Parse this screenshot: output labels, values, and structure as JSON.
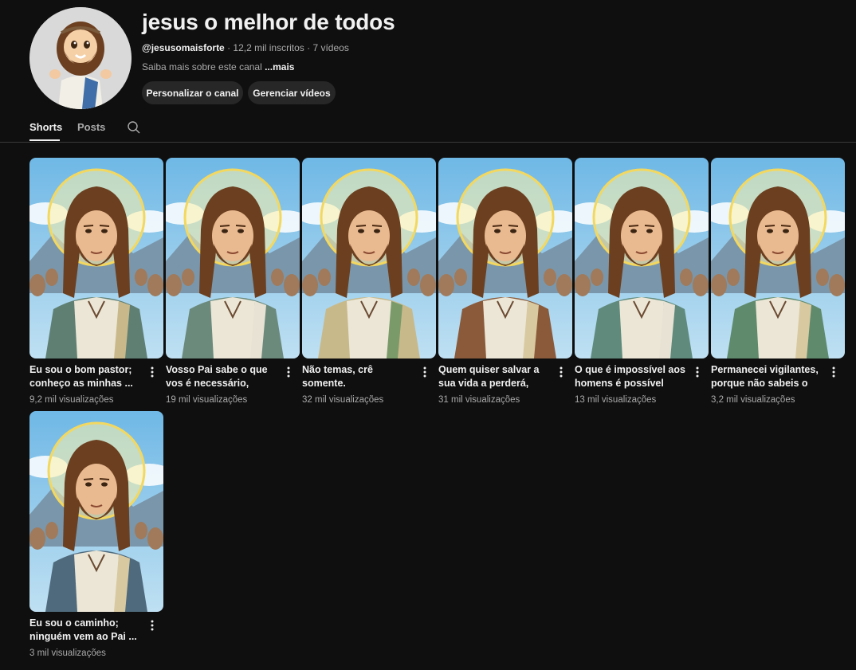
{
  "channel": {
    "name": "jesus o melhor de todos",
    "handle": "@jesusomaisforte",
    "subscribers": "· 12,2 mil inscritos",
    "video_count": "· 7 vídeos",
    "about_text": "Saiba mais sobre este canal",
    "about_more": "...mais",
    "customize_button": "Personalizar o canal",
    "manage_button": "Gerenciar vídeos",
    "avatar_icon": "jesus-cartoon-avatar"
  },
  "tabs": [
    {
      "label": "Shorts",
      "selected": true
    },
    {
      "label": "Posts",
      "selected": false
    }
  ],
  "shorts": [
    {
      "title": "Eu sou o bom pastor; conheço as minhas ...",
      "views": "9,2 mil visualizações"
    },
    {
      "title": "Vosso Pai sabe o que vos é necessário, ante...",
      "views": "19 mil visualizações"
    },
    {
      "title": "Não temas, crê somente.",
      "views": "32 mil visualizações"
    },
    {
      "title": "Quem quiser salvar a sua vida a perderá, ma...",
      "views": "31 mil visualizações"
    },
    {
      "title": "O que é impossível aos homens é possível par...",
      "views": "13 mil visualizações"
    },
    {
      "title": "Permanecei vigilantes, porque não sabeis o di...",
      "views": "3,2 mil visualizações"
    },
    {
      "title": "Eu sou o caminho; ninguém vem ao Pai ...",
      "views": "3 mil visualizações"
    }
  ],
  "colors": {
    "background": "#0f0f0f",
    "button_bg": "#272727",
    "secondary_text": "#aaaaaa",
    "primary_text": "#f1f1f1"
  }
}
